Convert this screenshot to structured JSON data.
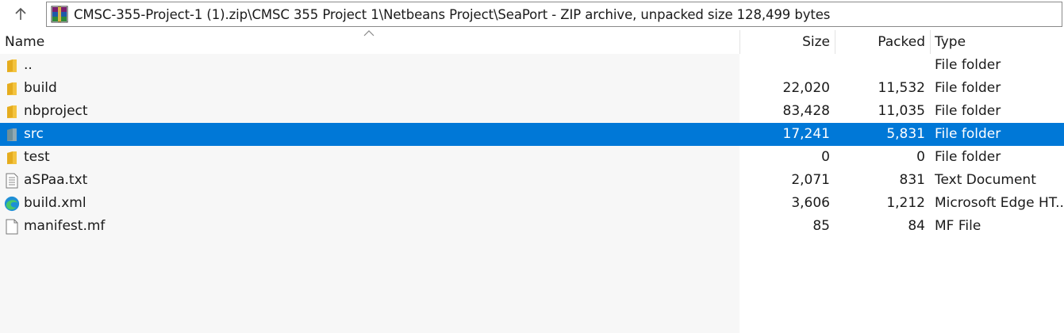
{
  "address": {
    "path": "CMSC-355-Project-1 (1).zip\\CMSC 355 Project 1\\Netbeans Project\\SeaPort - ZIP archive, unpacked size 128,499 bytes"
  },
  "columns": {
    "name": "Name",
    "size": "Size",
    "packed": "Packed",
    "type": "Type"
  },
  "rows": [
    {
      "name": "..",
      "size": "",
      "packed": "",
      "type": "File folder",
      "icon": "folder-icon"
    },
    {
      "name": "build",
      "size": "22,020",
      "packed": "11,532",
      "type": "File folder",
      "icon": "folder-icon"
    },
    {
      "name": "nbproject",
      "size": "83,428",
      "packed": "11,035",
      "type": "File folder",
      "icon": "folder-icon"
    },
    {
      "name": "src",
      "size": "17,241",
      "packed": "5,831",
      "type": "File folder",
      "icon": "folder-icon",
      "selected": true
    },
    {
      "name": "test",
      "size": "0",
      "packed": "0",
      "type": "File folder",
      "icon": "folder-icon"
    },
    {
      "name": "aSPaa.txt",
      "size": "2,071",
      "packed": "831",
      "type": "Text Document",
      "icon": "text-document-icon"
    },
    {
      "name": "build.xml",
      "size": "3,606",
      "packed": "1,212",
      "type": "Microsoft Edge HT...",
      "icon": "edge-icon"
    },
    {
      "name": "manifest.mf",
      "size": "85",
      "packed": "84",
      "type": "MF File",
      "icon": "blank-file-icon"
    }
  ],
  "colors": {
    "selection": "#0078d7",
    "folder": "#f3c33f",
    "name_column_bg": "#f7f7f7"
  }
}
